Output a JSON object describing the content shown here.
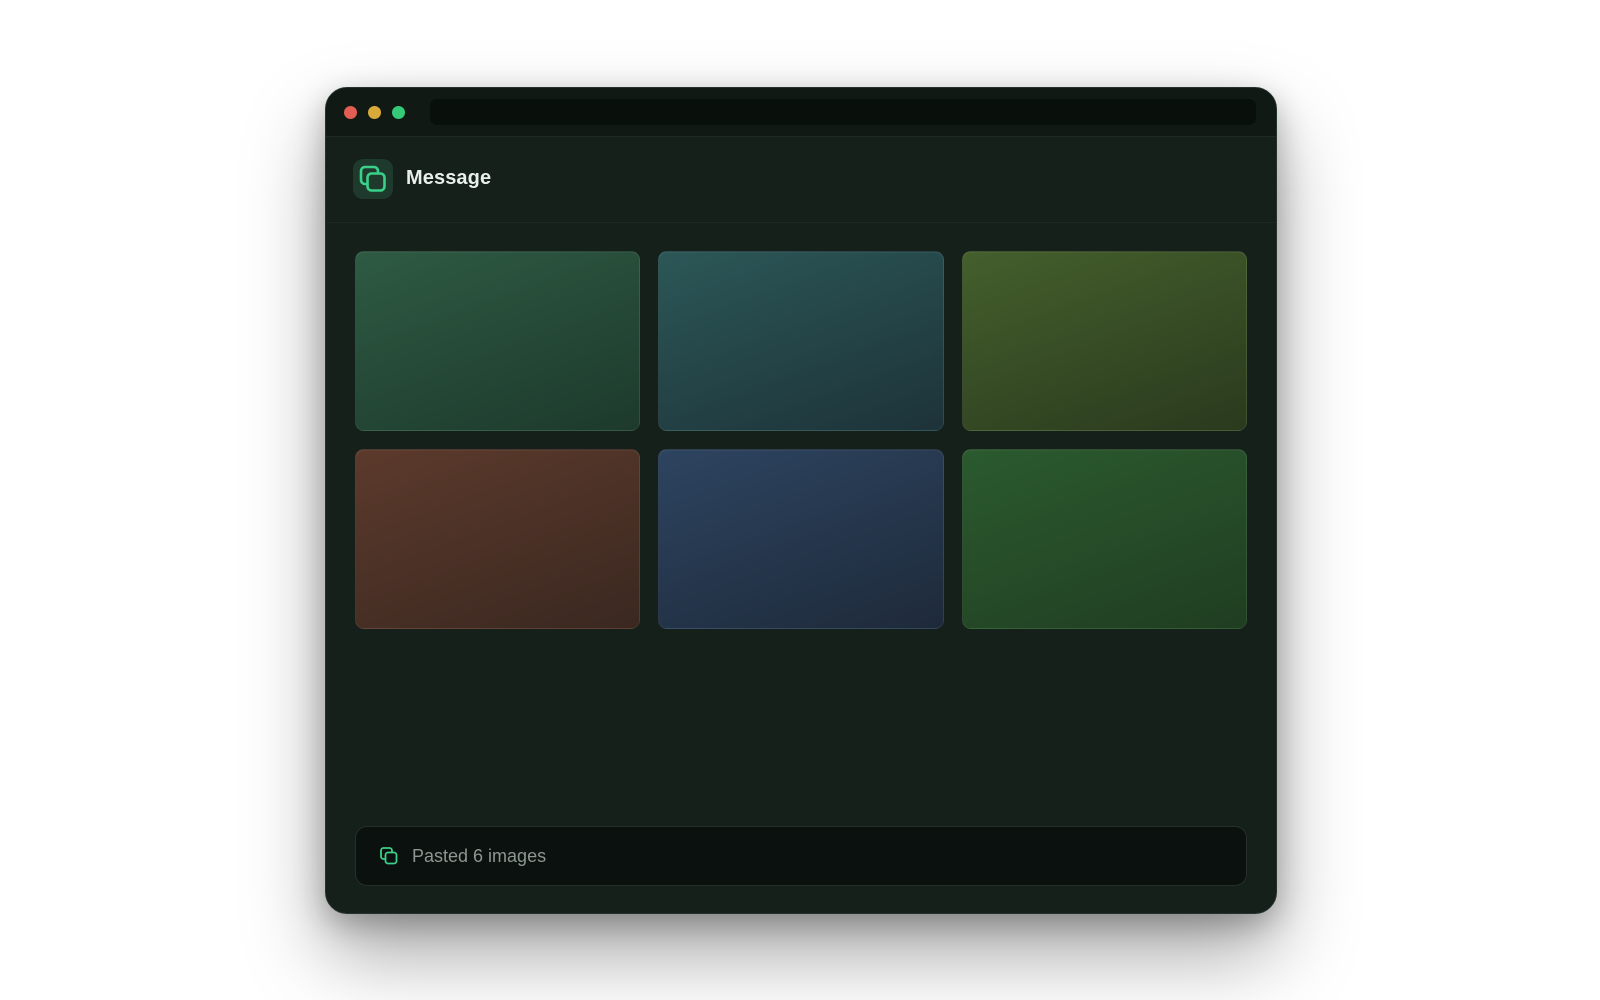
{
  "window": {
    "title_bar": {
      "controls": [
        {
          "name": "close",
          "color": "#e25d52"
        },
        {
          "name": "minimize",
          "color": "#d9a93a"
        },
        {
          "name": "zoom",
          "color": "#35c97a"
        }
      ]
    },
    "header": {
      "icon": "copy-icon",
      "title": "Message",
      "accent_color": "#3ad08a"
    },
    "attachments": [
      {
        "color_from": "#2e5a43",
        "color_to": "#1d3a2c"
      },
      {
        "color_from": "#2c5757",
        "color_to": "#1d3339"
      },
      {
        "color_from": "#445f2c",
        "color_to": "#2a3a1e"
      },
      {
        "color_from": "#5c3a2c",
        "color_to": "#3a2820"
      },
      {
        "color_from": "#2d4460",
        "color_to": "#1e2a3a"
      },
      {
        "color_from": "#2b5a2e",
        "color_to": "#203e22"
      }
    ],
    "composer": {
      "icon": "copy-icon",
      "status_text": "Pasted 6 images"
    }
  }
}
